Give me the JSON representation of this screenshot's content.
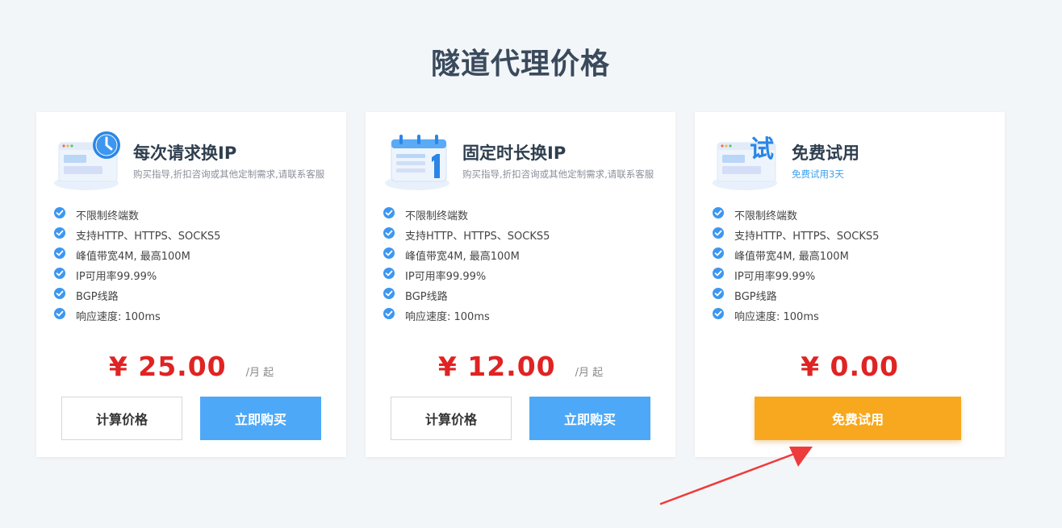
{
  "page": {
    "title": "隧道代理价格"
  },
  "colors": {
    "accent_blue": "#4da9f7",
    "price_red": "#e02323",
    "trial_orange": "#f7a81e",
    "arrow_red": "#ee3b3b"
  },
  "cards": [
    {
      "icon": "clock-window-icon",
      "title": "每次请求换IP",
      "subtitle": "购买指导,折扣咨询或其他定制需求,请联系客服",
      "features": [
        "不限制终端数",
        "支持HTTP、HTTPS、SOCKS5",
        "峰值带宽4M, 最高100M",
        "IP可用率99.99%",
        "BGP线路",
        "响应速度: 100ms"
      ],
      "price": "¥ 25.00",
      "price_unit": "/月 起",
      "calc_label": "计算价格",
      "buy_label": "立即购买"
    },
    {
      "icon": "calendar-icon",
      "title": "固定时长换IP",
      "subtitle": "购买指导,折扣咨询或其他定制需求,请联系客服",
      "features": [
        "不限制终端数",
        "支持HTTP、HTTPS、SOCKS5",
        "峰值带宽4M, 最高100M",
        "IP可用率99.99%",
        "BGP线路",
        "响应速度: 100ms"
      ],
      "price": "¥ 12.00",
      "price_unit": "/月 起",
      "calc_label": "计算价格",
      "buy_label": "立即购买"
    },
    {
      "icon": "trial-window-icon",
      "icon_text": "试",
      "title": "免费试用",
      "subtitle": "免费试用3天",
      "features": [
        "不限制终端数",
        "支持HTTP、HTTPS、SOCKS5",
        "峰值带宽4M, 最高100M",
        "IP可用率99.99%",
        "BGP线路",
        "响应速度: 100ms"
      ],
      "price": "¥ 0.00",
      "trial_label": "免费试用"
    }
  ]
}
